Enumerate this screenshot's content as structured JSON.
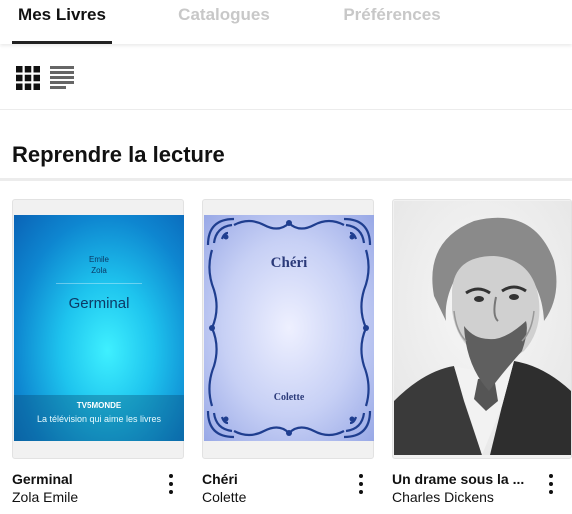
{
  "tabs": [
    {
      "label": "Mes Livres",
      "active": true
    },
    {
      "label": "Catalogues",
      "active": false
    },
    {
      "label": "Préférences",
      "active": false
    }
  ],
  "view_toggles": {
    "grid_icon": "grid-view-icon",
    "list_icon": "list-view-icon",
    "selected": "grid"
  },
  "section": {
    "title": "Reprendre la lecture"
  },
  "books": [
    {
      "title": "Germinal",
      "author": "Zola Emile",
      "cover": {
        "author_line1": "Emile",
        "author_line2": "Zola",
        "title": "Germinal",
        "brand": "TV5MONDE",
        "tagline": "La télévision qui aime les livres"
      }
    },
    {
      "title": "Chéri",
      "author": "Colette",
      "cover": {
        "title": "Chéri",
        "author": "Colette"
      }
    },
    {
      "title": "Un drame sous la ...",
      "author": "Charles Dickens",
      "cover": {
        "image": "portrait-engraving"
      }
    }
  ],
  "colors": {
    "active_tab": "#111111",
    "inactive_tab": "#c8c8c8",
    "germinal_cover": "#1ec4ee",
    "cheri_cover": "#c7d0f5",
    "cheri_ornament": "#1f3e8f"
  }
}
